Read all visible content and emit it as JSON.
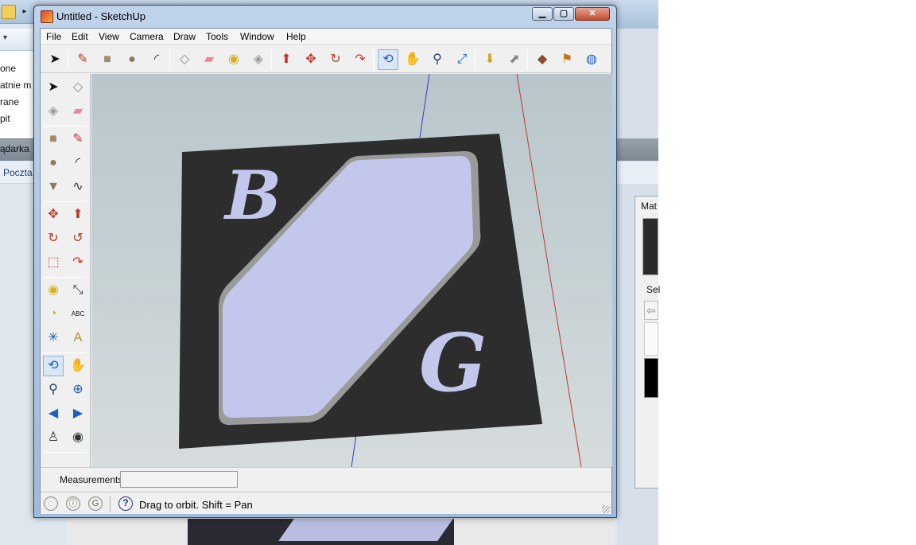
{
  "background_app": {
    "nav_items": [
      "one",
      "atnie m",
      "rane",
      "pit"
    ],
    "tab_label": "ądarka",
    "row_label": "Poczta",
    "arrow_glyph": "▸",
    "dropdown_glyph": "▾"
  },
  "materials_panel": {
    "title": "Mat",
    "select_label": "Sel",
    "back_glyph": "⇦"
  },
  "window": {
    "title": "Untitled - SketchUp",
    "min_glyph": "▁",
    "max_glyph": "▢",
    "close_glyph": "✕"
  },
  "menu": [
    "File",
    "Edit",
    "View",
    "Camera",
    "Draw",
    "Tools",
    "Window",
    "Help"
  ],
  "top_toolbar": [
    {
      "name": "select-tool",
      "glyph": "➤",
      "color": "#111111"
    },
    {
      "name": "pencil-tool",
      "glyph": "✎",
      "color": "#c0392b"
    },
    {
      "name": "rectangle-tool",
      "glyph": "■",
      "color": "#a08b6a"
    },
    {
      "name": "circle-tool",
      "glyph": "●",
      "color": "#8a7a60"
    },
    {
      "name": "arc-tool",
      "glyph": "◜",
      "color": "#333333"
    },
    {
      "name": "make-component-tool",
      "glyph": "◇",
      "color": "#888888"
    },
    {
      "name": "eraser-tool",
      "glyph": "▰",
      "color": "#e28aa0"
    },
    {
      "name": "tape-measure-tool",
      "glyph": "◉",
      "color": "#d4b21b"
    },
    {
      "name": "paint-bucket-tool",
      "glyph": "◈",
      "color": "#999999"
    },
    {
      "name": "push-pull-tool",
      "glyph": "⬆",
      "color": "#c0392b"
    },
    {
      "name": "move-tool",
      "glyph": "✥",
      "color": "#c0392b"
    },
    {
      "name": "rotate-tool",
      "glyph": "↻",
      "color": "#c0392b"
    },
    {
      "name": "follow-me-tool",
      "glyph": "↷",
      "color": "#c0392b"
    },
    {
      "name": "orbit-tool",
      "glyph": "⟲",
      "color": "#1f5fbf"
    },
    {
      "name": "pan-tool",
      "glyph": "✋",
      "color": "#555555"
    },
    {
      "name": "zoom-tool",
      "glyph": "⚲",
      "color": "#1f3f7a"
    },
    {
      "name": "zoom-extents-tool",
      "glyph": "⤢",
      "color": "#1f5fbf"
    },
    {
      "name": "get-models-tool",
      "glyph": "⬇",
      "color": "#d4a21b"
    },
    {
      "name": "share-model-tool",
      "glyph": "⬈",
      "color": "#888888"
    },
    {
      "name": "components-tool",
      "glyph": "◆",
      "color": "#8b4a2b"
    },
    {
      "name": "place-model-tool",
      "glyph": "⚑",
      "color": "#c07a1b"
    },
    {
      "name": "google-earth-tool",
      "glyph": "◍",
      "color": "#1f5fbf"
    }
  ],
  "left_toolbar": [
    {
      "name": "select-tool",
      "glyph": "➤",
      "color": "#111111"
    },
    {
      "name": "make-component-tool",
      "glyph": "◇",
      "color": "#888888"
    },
    {
      "name": "paint-bucket-tool",
      "glyph": "◈",
      "color": "#999999"
    },
    {
      "name": "eraser-tool",
      "glyph": "▰",
      "color": "#e28aa0"
    },
    {
      "name": "rectangle-tool",
      "glyph": "■",
      "color": "#a08b6a"
    },
    {
      "name": "pencil-tool",
      "glyph": "✎",
      "color": "#c0392b"
    },
    {
      "name": "circle-tool",
      "glyph": "●",
      "color": "#8a7a60"
    },
    {
      "name": "arc-tool",
      "glyph": "◜",
      "color": "#333333"
    },
    {
      "name": "polygon-tool",
      "glyph": "▼",
      "color": "#8a7a60"
    },
    {
      "name": "freehand-tool",
      "glyph": "∿",
      "color": "#333333"
    },
    {
      "name": "move-tool",
      "glyph": "✥",
      "color": "#c0392b"
    },
    {
      "name": "push-pull-tool",
      "glyph": "⬆",
      "color": "#c0392b"
    },
    {
      "name": "rotate-tool",
      "glyph": "↻",
      "color": "#c0392b"
    },
    {
      "name": "follow-me-tool",
      "glyph": "↺",
      "color": "#c0392b"
    },
    {
      "name": "scale-tool",
      "glyph": "⬚",
      "color": "#c0392b"
    },
    {
      "name": "offset-tool",
      "glyph": "↷",
      "color": "#c0392b"
    },
    {
      "name": "tape-measure-tool",
      "glyph": "◉",
      "color": "#d4b21b"
    },
    {
      "name": "dimension-tool",
      "glyph": "⤡",
      "color": "#333333"
    },
    {
      "name": "protractor-tool",
      "glyph": "◔",
      "color": "#d4b21b"
    },
    {
      "name": "text-tool",
      "glyph": "ABC",
      "color": "#111111"
    },
    {
      "name": "axes-tool",
      "glyph": "✳",
      "color": "#1f5fbf"
    },
    {
      "name": "3d-text-tool",
      "glyph": "A",
      "color": "#b08b2b"
    },
    {
      "name": "orbit-tool",
      "glyph": "⟲",
      "color": "#1f5fbf"
    },
    {
      "name": "pan-tool",
      "glyph": "✋",
      "color": "#555555"
    },
    {
      "name": "zoom-tool",
      "glyph": "⚲",
      "color": "#1f3f7a"
    },
    {
      "name": "zoom-window-tool",
      "glyph": "⊕",
      "color": "#1f5fbf"
    },
    {
      "name": "previous-view-tool",
      "glyph": "◀",
      "color": "#1f5fbf"
    },
    {
      "name": "next-view-tool",
      "glyph": "▶",
      "color": "#1f5fbf"
    },
    {
      "name": "position-camera-tool",
      "glyph": "♙",
      "color": "#333333"
    },
    {
      "name": "look-around-tool",
      "glyph": "◉",
      "color": "#333333"
    }
  ],
  "scene": {
    "letter_top": "B",
    "letter_bottom": "G",
    "plate_color": "#2d2d2d",
    "inset_color": "#c4c7ec",
    "axis_blue": "#2b3bd0",
    "axis_red": "#c0392b"
  },
  "measurements": {
    "label": "Measurements",
    "value": ""
  },
  "status": {
    "icons": [
      "geo-location-icon",
      "credits-icon",
      "google-signin-icon"
    ],
    "icon_glyphs": [
      "◌",
      "ⓘ",
      "G"
    ],
    "help_glyph": "?",
    "text": "Drag to orbit.  Shift = Pan"
  }
}
